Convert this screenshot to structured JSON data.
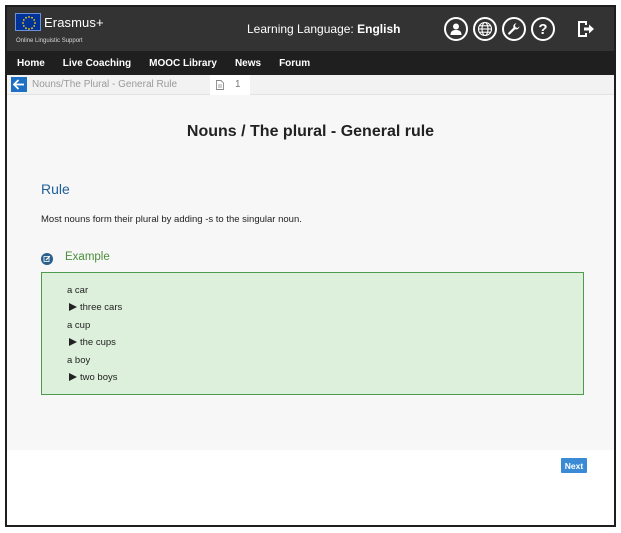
{
  "header": {
    "logo_text": "Erasmus+",
    "logo_subtitle": "Online Linguistic Support",
    "language_label": "Learning Language: ",
    "language_value": "English",
    "help_glyph": "?",
    "icons": [
      "profile-icon",
      "globe-icon",
      "wrench-icon",
      "help-icon",
      "logout-icon"
    ]
  },
  "nav": {
    "items": [
      "Home",
      "Live Coaching",
      "MOOC Library",
      "News",
      "Forum"
    ]
  },
  "breadcrumb": {
    "path": "Nouns/The Plural - General Rule",
    "page": "1"
  },
  "lesson": {
    "title": "Nouns / The plural - General rule",
    "section": "Rule",
    "text": "Most nouns form their plural by adding -s to the singular noun.",
    "example_label": "Example",
    "examples": [
      {
        "singular": "a car",
        "plural": "three cars"
      },
      {
        "singular": "a cup",
        "plural": "the cups"
      },
      {
        "singular": "a boy",
        "plural": "two boys"
      }
    ]
  },
  "footer": {
    "next_label": "Next"
  },
  "colors": {
    "topbar": "#333333",
    "nav": "#1f1f1f",
    "accent_blue": "#1f5f98",
    "button_blue": "#3a8ad6",
    "example_green_bg": "#dcf0dc",
    "example_green_border": "#4e9a4e",
    "example_label_green": "#4a8e3a"
  }
}
